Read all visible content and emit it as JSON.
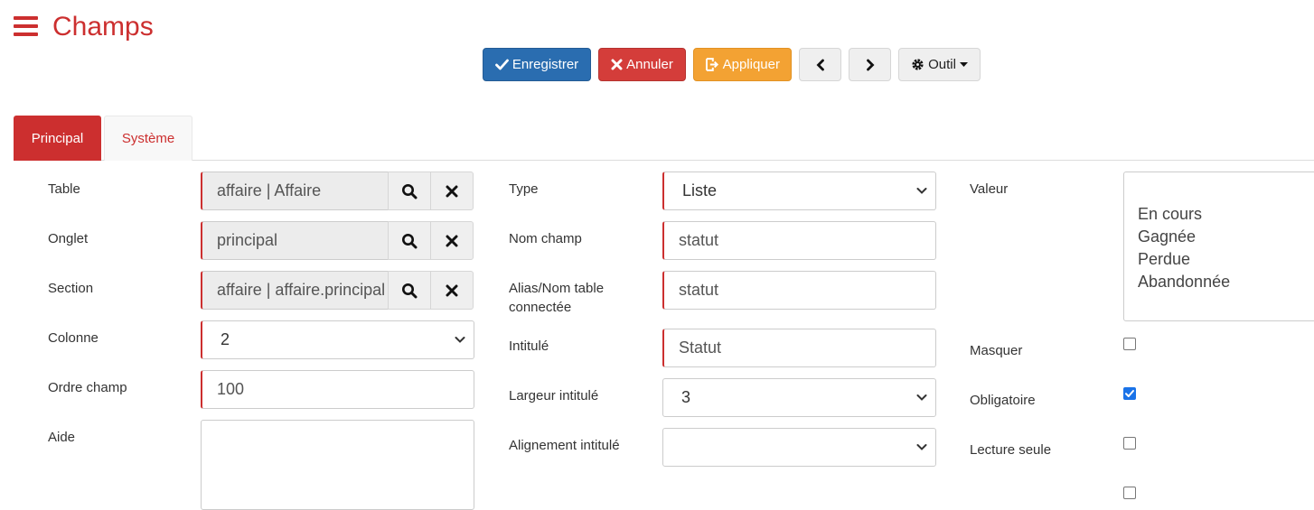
{
  "header": {
    "title": "Champs"
  },
  "toolbar": {
    "save_label": "Enregistrer",
    "cancel_label": "Annuler",
    "apply_label": "Appliquer",
    "tool_label": "Outil"
  },
  "tabs": [
    {
      "label": "Principal",
      "active": true
    },
    {
      "label": "Système",
      "active": false
    }
  ],
  "left": {
    "table_label": "Table",
    "table_value": "affaire | Affaire",
    "onglet_label": "Onglet",
    "onglet_value": "principal",
    "section_label": "Section",
    "section_value": "affaire | affaire.principal",
    "colonne_label": "Colonne",
    "colonne_value": "2",
    "ordre_label": "Ordre champ",
    "ordre_value": "100",
    "aide_label": "Aide",
    "aide_value": ""
  },
  "middle": {
    "type_label": "Type",
    "type_value": "Liste",
    "nom_label": "Nom champ",
    "nom_value": "statut",
    "alias_label_1": "Alias/Nom table",
    "alias_label_2": "connectée",
    "alias_value": "statut",
    "intitule_label": "Intitulé",
    "intitule_value": "Statut",
    "largeur_label": "Largeur intitulé",
    "largeur_value": "3",
    "alignement_label": "Alignement intitulé",
    "alignement_value": ""
  },
  "right": {
    "valeur_label": "Valeur",
    "valeur_lines": [
      "En cours",
      "Gagnée",
      "Perdue",
      "Abandonnée"
    ],
    "masquer_label": "Masquer",
    "masquer_checked": false,
    "obligatoire_label": "Obligatoire",
    "obligatoire_checked": true,
    "lecture_label": "Lecture seule",
    "lecture_checked": false
  },
  "colors": {
    "brand_red": "#cc2f2f",
    "primary_blue": "#2a6db0",
    "danger_red": "#d43d3a",
    "warning_orange": "#f3a233"
  },
  "icons": {
    "menu": "hamburger-menu-icon",
    "save": "check-icon",
    "cancel": "times-icon",
    "apply": "apply-icon",
    "prev": "chevron-left-icon",
    "next": "chevron-right-icon",
    "tool": "gear-icon",
    "search": "search-icon",
    "clear": "times-icon"
  }
}
